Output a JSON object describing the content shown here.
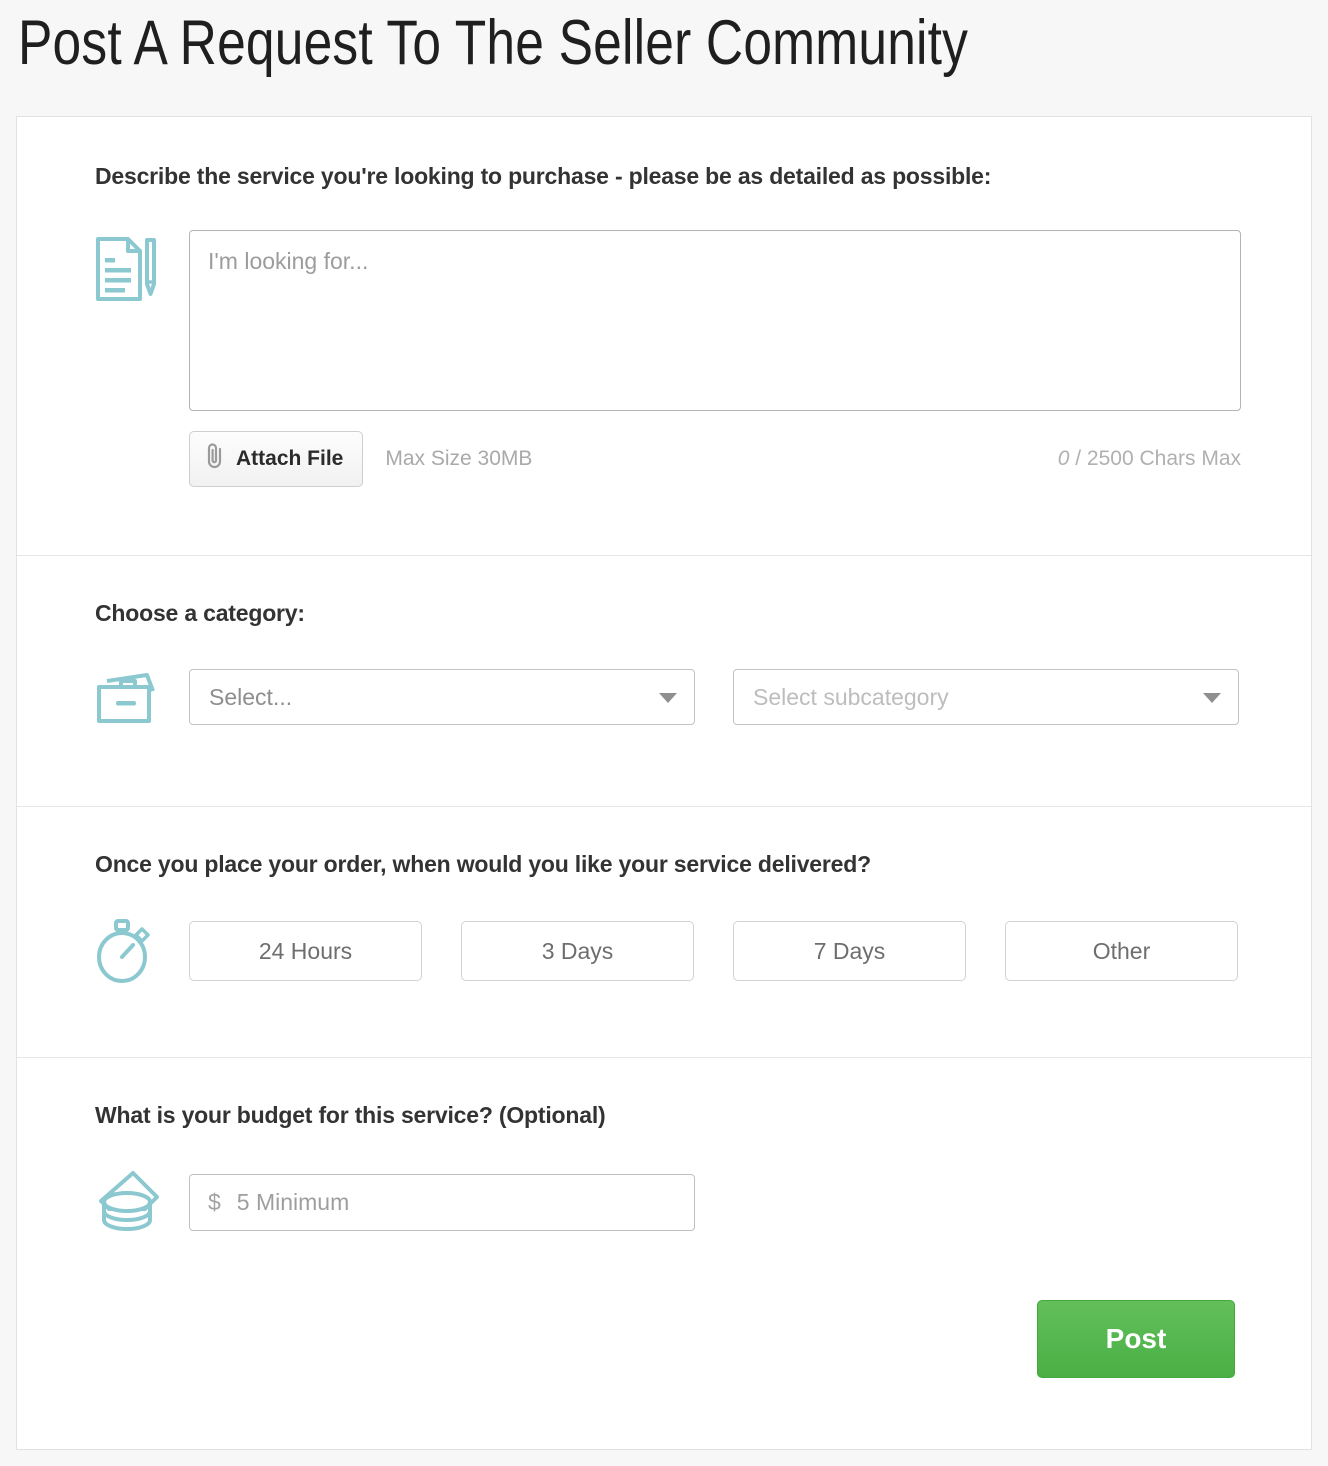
{
  "page": {
    "title": "Post A Request To The Seller Community",
    "background_color": "#f7f7f7",
    "accent_icon_color": "#8bc8d0",
    "post_button_color": "#4aaf45"
  },
  "describe": {
    "label": "Describe the service you're looking to purchase - please be as detailed as possible:",
    "icon": "document-pencil-icon",
    "textarea_placeholder": "I'm looking for...",
    "textarea_value": "",
    "attach_button_label": "Attach File",
    "attach_icon": "paperclip-icon",
    "max_size_note": "Max Size 30MB",
    "char_count_current": "0",
    "char_count_suffix": "/ 2500 Chars Max"
  },
  "category": {
    "label": "Choose a category:",
    "icon": "folder-icon",
    "primary_select_value": "Select...",
    "subcategory_select_value": "Select subcategory"
  },
  "delivery": {
    "label": "Once you place your order, when would you like your service delivered?",
    "icon": "stopwatch-icon",
    "options": [
      {
        "label": "24 Hours"
      },
      {
        "label": "3 Days"
      },
      {
        "label": "7 Days"
      },
      {
        "label": "Other"
      }
    ]
  },
  "budget": {
    "label": "What is your budget for this service? (Optional)",
    "icon": "coins-icon",
    "currency_symbol": "$",
    "input_placeholder": "5 Minimum",
    "input_value": "",
    "post_button_label": "Post"
  }
}
